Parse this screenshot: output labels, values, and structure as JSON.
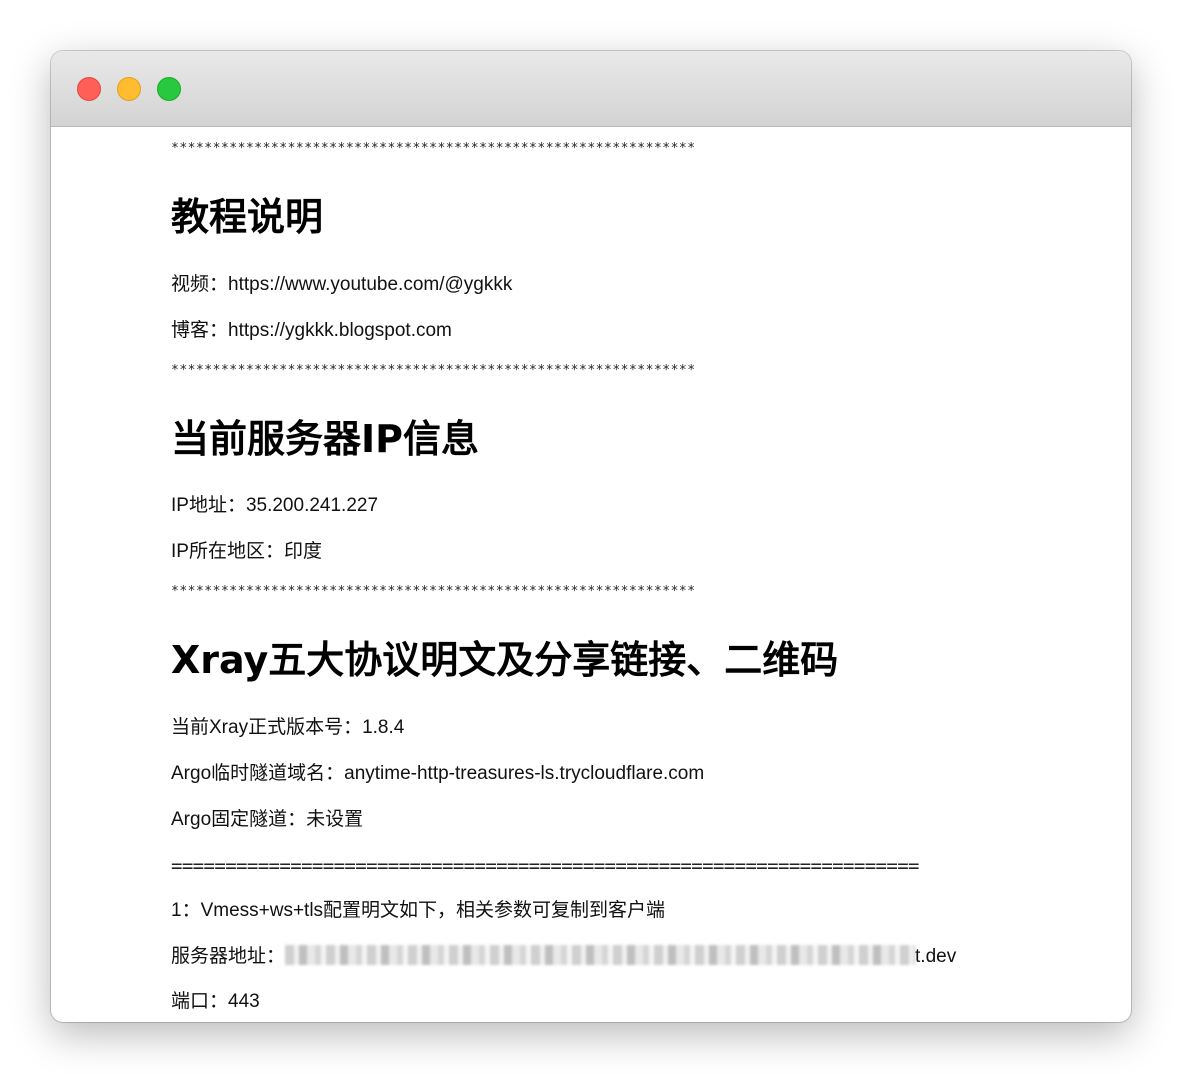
{
  "separator_stars": "***************************************************************",
  "separator_eq": "=====================================================================",
  "section1": {
    "heading": "教程说明",
    "video": "视频：https://www.youtube.com/@ygkkk",
    "blog": "博客：https://ygkkk.blogspot.com"
  },
  "section2": {
    "heading": "当前服务器IP信息",
    "ip": "IP地址：35.200.241.227",
    "region": "IP所在地区：印度"
  },
  "section3": {
    "heading": "Xray五大协议明文及分享链接、二维码",
    "version": "当前Xray正式版本号：1.8.4",
    "argo_temp": "Argo临时隧道域名：anytime-http-treasures-ls.trycloudflare.com",
    "argo_fixed": "Argo固定隧道：未设置",
    "vmess_title": "1：Vmess+ws+tls配置明文如下，相关参数可复制到客户端",
    "server_label": "服务器地址：",
    "server_suffix": "t.dev",
    "port": "端口：443"
  }
}
